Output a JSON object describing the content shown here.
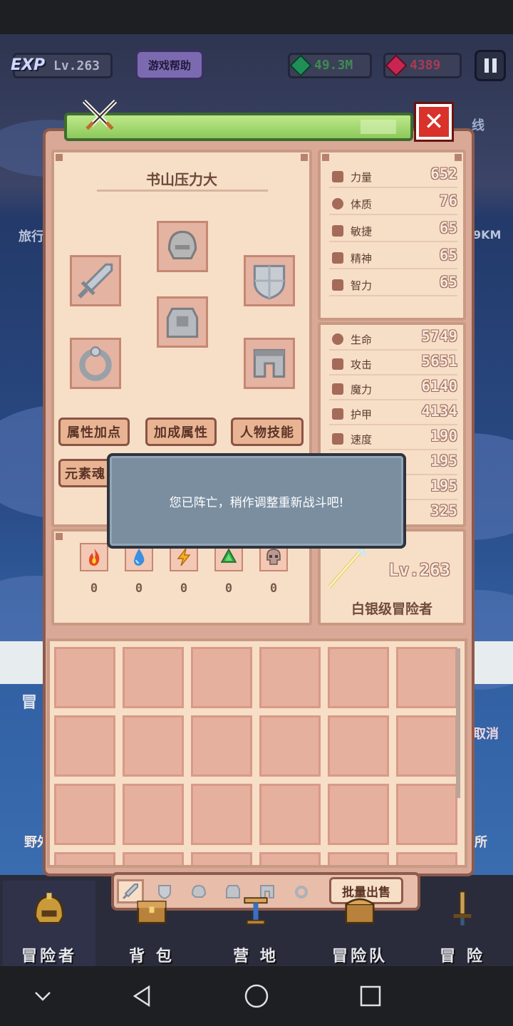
{
  "hud": {
    "exp_tag": "EXP",
    "level": "Lv.263",
    "help_button": "游戏帮助",
    "green_gems": "49.3M",
    "red_gems": "4389"
  },
  "background_fragments": {
    "left_travel": "旅行",
    "right_top": "线",
    "right_km": "9KM",
    "left_adv": "冒",
    "right_cancel": "取消",
    "left_wild": "野外",
    "right_place": "所"
  },
  "panel": {
    "character_name": "书山压力大",
    "buttons": {
      "attr_points": "属性加点",
      "bonus_attr": "加成属性",
      "char_skills": "人物技能",
      "element_soul": "元素魂"
    },
    "base_stats": [
      {
        "name": "力量",
        "value": "652"
      },
      {
        "name": "体质",
        "value": "76"
      },
      {
        "name": "敏捷",
        "value": "65"
      },
      {
        "name": "精神",
        "value": "65"
      },
      {
        "name": "智力",
        "value": "65"
      }
    ],
    "combat_stats": [
      {
        "name": "生命",
        "value": "5749"
      },
      {
        "name": "攻击",
        "value": "5651"
      },
      {
        "name": "魔力",
        "value": "6140"
      },
      {
        "name": "护甲",
        "value": "4134"
      },
      {
        "name": "速度",
        "value": "190"
      },
      {
        "name": "",
        "value": "195"
      },
      {
        "name": "",
        "value": "195"
      },
      {
        "name": "",
        "value": "325"
      }
    ],
    "elements": [
      {
        "icon": "fire-icon",
        "value": "0"
      },
      {
        "icon": "water-icon",
        "value": "0"
      },
      {
        "icon": "lightning-icon",
        "value": "0"
      },
      {
        "icon": "earth-icon",
        "value": "0"
      },
      {
        "icon": "skull-icon",
        "value": "0"
      }
    ],
    "player_level": "Lv.263",
    "rank": "白银级冒险者",
    "sell_button": "批量出售"
  },
  "dialog": {
    "message": "您已阵亡，稍作调整重新战斗吧!"
  },
  "bottom_menu": [
    {
      "label": "冒险者"
    },
    {
      "label": "背 包"
    },
    {
      "label": "营 地"
    },
    {
      "label": "冒险队"
    },
    {
      "label": "冒 险"
    }
  ],
  "colors": {
    "panel": "#d9a897",
    "panel_inner": "#f7dec7",
    "dialog": "#7a8ea0",
    "header_green": "#8cc95c",
    "close_red": "#d8322a"
  }
}
